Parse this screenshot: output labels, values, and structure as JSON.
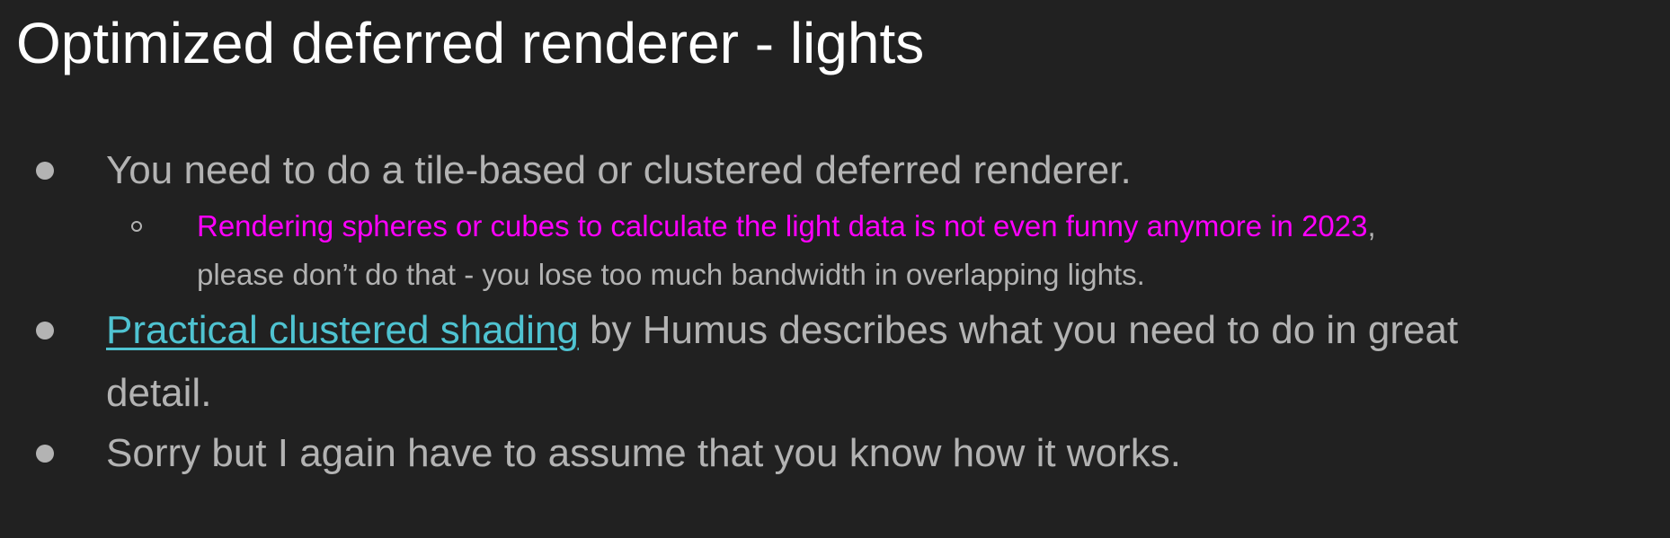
{
  "slide": {
    "title": "Optimized deferred renderer - lights",
    "bullet1": "You need to do a tile-based or clustered deferred renderer.",
    "sub_bullet": {
      "highlight": "Rendering spheres or cubes to calculate the light data is not even funny anymore in 2023",
      "comma": ",",
      "rest": "please don’t do that - you lose too much bandwidth in overlapping lights."
    },
    "bullet2": {
      "link_text": "Practical clustered shading",
      "line1_rest": " by Humus describes what you need to do in great",
      "line2": "detail."
    },
    "bullet3": "Sorry but I again have to assume that you know how it works."
  },
  "colors": {
    "background": "#212121",
    "title": "#ffffff",
    "body_text": "#b3b3b3",
    "highlight": "#ff00ff",
    "link": "#4fc3d1"
  }
}
